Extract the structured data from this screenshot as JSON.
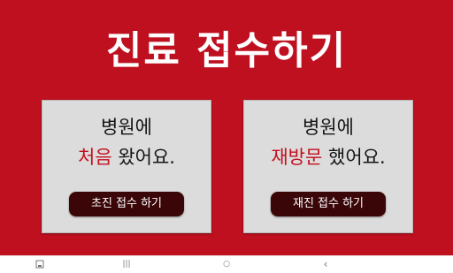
{
  "header": {
    "title": "진료 접수하기"
  },
  "cards": [
    {
      "line1": "병원에",
      "highlight": "처음",
      "rest": " 왔어요.",
      "button_label": "초진 접수 하기"
    },
    {
      "line1": "병원에",
      "highlight": "재방문",
      "rest": " 했어요.",
      "button_label": "재진 접수 하기"
    }
  ],
  "colors": {
    "background": "#bf1020",
    "highlight": "#c40e1e",
    "button": "#3a0608"
  },
  "navbar": {
    "icons": [
      "screenshot-icon",
      "recents-icon",
      "home-icon",
      "back-icon"
    ],
    "glyphs": {
      "recents": "|||",
      "home": "○",
      "back": "‹"
    }
  }
}
